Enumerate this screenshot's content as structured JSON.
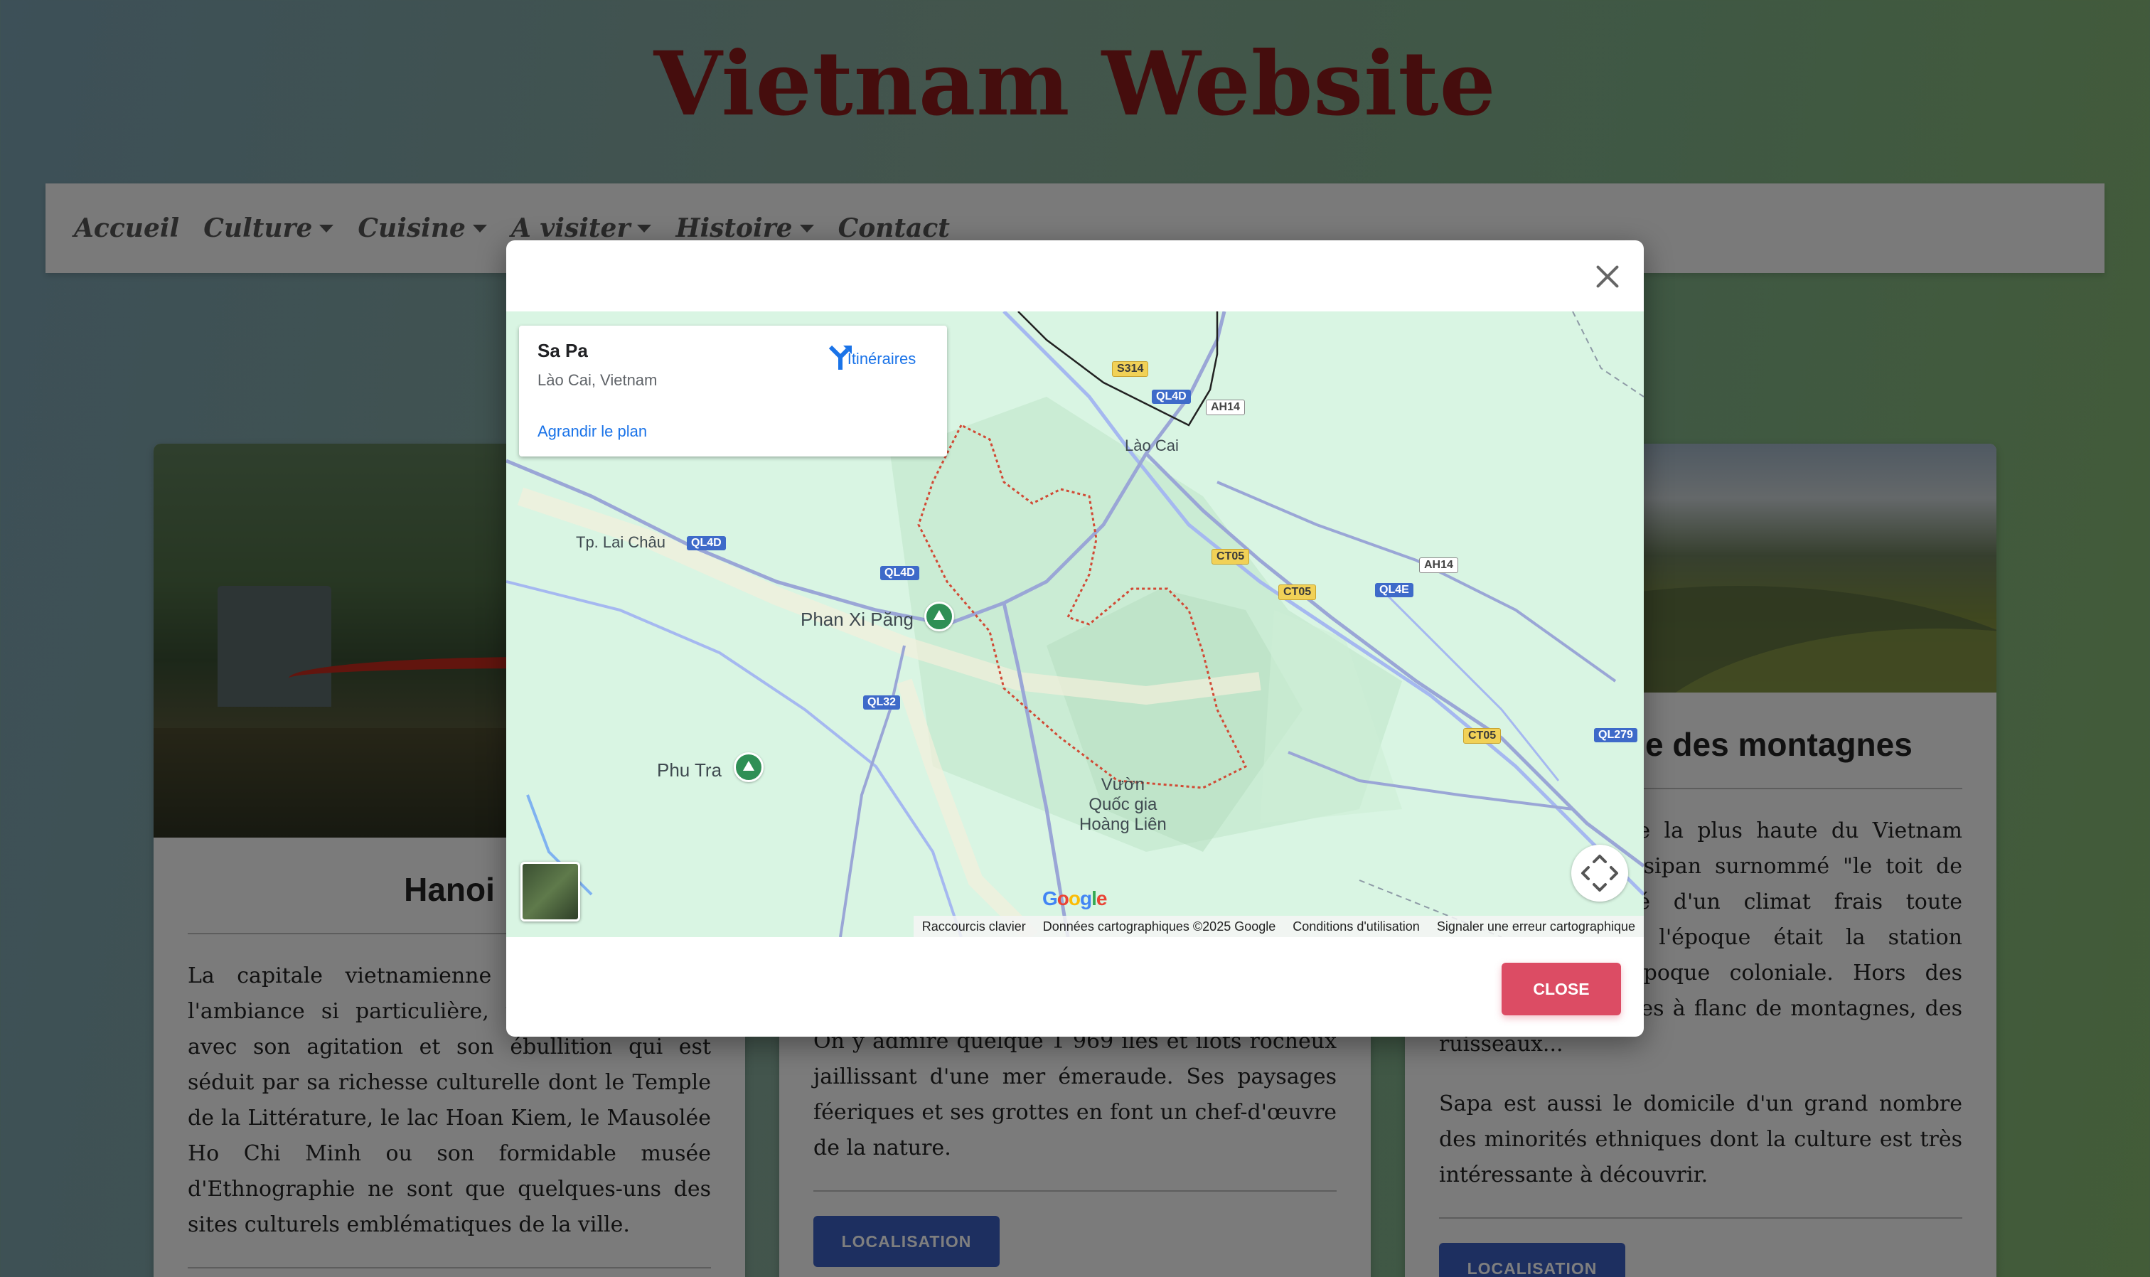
{
  "site": {
    "title": "Vietnam Website"
  },
  "nav": {
    "items": [
      {
        "label": "Accueil",
        "dropdown": false
      },
      {
        "label": "Culture",
        "dropdown": true
      },
      {
        "label": "Cuisine",
        "dropdown": true
      },
      {
        "label": "A visiter",
        "dropdown": true
      },
      {
        "label": "Histoire",
        "dropdown": true
      },
      {
        "label": "Contact",
        "dropdown": false
      }
    ]
  },
  "cards": {
    "hanoi": {
      "title": "Hanoi",
      "text": "La capitale vietnamienne est une ville à l'ambiance si particulière, typique de l'Asie, avec son agitation et son ébullition qui est séduit par sa richesse culturelle dont le Temple de la Littérature, le lac Hoan Kiem, le Mausolée Ho Chi Minh ou son formidable musée d'Ethnographie ne sont que quelques-uns des sites culturels emblématiques de la ville."
    },
    "halong": {
      "text": "On y admire quelque 1 969 îles et îlots rocheux jaillissant d'une mer émeraude. Ses paysages féeriques et ses grottes en font un chef-d'œuvre de la nature.",
      "button": "LOCALISATION"
    },
    "sapa": {
      "title": "Sapa, reine des montagnes",
      "text1": "Sapa est la partie la plus haute du Vietnam avec le mont Fansipan surnommé \"le toit de l'Indochine\". Doté d'un climat frais toute l'année, Sapa à l'époque était la station climatique de l'époque coloniale. Hors des rizières en terrasses à flanc de montagnes, des ruisseaux...",
      "text2": "Sapa est aussi le domicile d'un grand nombre des minorités ethniques dont la culture est très intéressante à découvrir.",
      "button": "LOCALISATION"
    }
  },
  "modal": {
    "close_label": "CLOSE",
    "map": {
      "place": {
        "name": "Sa Pa",
        "region": "Lào Cai, Vietnam"
      },
      "directions_label": "Itinéraires",
      "enlarge_label": "Agrandir le plan",
      "labels": {
        "lao_cai": "Lào Cai",
        "lai_chau": "Tp. Lai Châu",
        "phan_xi_pang": "Phan Xi Păng",
        "phu_tra": "Phu Tra",
        "park": "Vườn\nQuốc gia\nHoàng Liên"
      },
      "shields": {
        "s314": "S314",
        "ql4d": "QL4D",
        "ah14": "AH14",
        "ct05": "CT05",
        "ql4e": "QL4E",
        "ql32": "QL32",
        "ql279": "QL279"
      },
      "google": "Google",
      "attribution": [
        "Raccourcis clavier",
        "Données cartographiques ©2025 Google",
        "Conditions d'utilisation",
        "Signaler une erreur cartographique"
      ]
    }
  },
  "colors": {
    "title_red": "#8b1a1a",
    "button_blue": "#3b5fc0",
    "close_red": "#dc4c64",
    "map_green": "#d9f5e3"
  }
}
